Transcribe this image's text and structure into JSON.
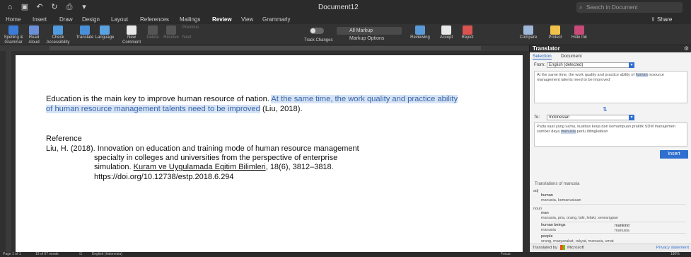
{
  "titlebar": {
    "title": "Document12",
    "search_placeholder": "Search in Document"
  },
  "menu_tabs": [
    {
      "label": "Home"
    },
    {
      "label": "Insert"
    },
    {
      "label": "Draw"
    },
    {
      "label": "Design"
    },
    {
      "label": "Layout"
    },
    {
      "label": "References"
    },
    {
      "label": "Mailings"
    },
    {
      "label": "Review"
    },
    {
      "label": "View"
    },
    {
      "label": "Grammarly"
    }
  ],
  "share_label": "Share",
  "ribbon": {
    "spelling": "Spelling & Grammar",
    "read_aloud": "Read Aloud",
    "check_accessibility": "Check Accessibility",
    "translate": "Translate",
    "language": "Language",
    "new_comment": "New Comment",
    "delete": "Delete",
    "resolve": "Resolve",
    "previous": "Previous",
    "next": "Next",
    "track_changes": "Track Changes",
    "markup_select": "All Markup",
    "markup_options": "Markup Options",
    "reviewing": "Reviewing",
    "accept": "Accept",
    "reject": "Reject",
    "compare": "Compare",
    "protect": "Protect",
    "hide_ink": "Hide Ink"
  },
  "document": {
    "para_plain": "Education is the main key to improve human resource of nation. ",
    "para_highlight": "At the same time, the work quality and practice ability of human resource management talents need to be improved",
    "para_cite": " (Liu, 2018).",
    "reference_heading": "Reference",
    "ref_line1": "Liu, H. (2018). Innovation on education and training mode of human resource management",
    "ref_line2": "specialty in colleges and universities from the perspective of enterprise",
    "ref_line3_pre": "simulation. ",
    "ref_journal": "Kuram ve Uygulamada Egitim Bilimleri",
    "ref_line3_post": ", 18(6), 3812–3818.",
    "ref_doi": "https://doi.org/10.12738/estp.2018.6.294"
  },
  "status": {
    "page": "Page 1 of 1",
    "words": "19 of 67 words",
    "language": "English (Indonesia)",
    "focus": "Focus",
    "zoom": "180%"
  },
  "translator": {
    "title": "Translator",
    "tab_selection": "Selection",
    "tab_document": "Document",
    "from_label": "From:",
    "from_value": "English (detected)",
    "source_pre": "At the same time, the work quality and practice ability of ",
    "source_word": "human",
    "source_post": " resource management talents need to be improved",
    "to_label": "To:",
    "to_value": "Indonesian",
    "target_pre": "Pada saat yang sama, kualitas kerja dan kemampuan praktik SDM manajemen sumber daya ",
    "target_word": "manusia",
    "target_post": " perlu ditingkatkan",
    "insert_label": "Insert",
    "dict_title": "Translations of manusia",
    "dict": [
      {
        "pos": "adj",
        "word": "human",
        "alts": "manusia, kemanusiaan"
      },
      {
        "pos": "noun",
        "word": "man",
        "alts": "manusia, pria, orang, laki, lelaki, seorangpun"
      },
      {
        "pos": "",
        "word": "human beings",
        "alts": "manusia"
      },
      {
        "pos": "",
        "word": "mankind",
        "alts": "manusia"
      },
      {
        "pos": "",
        "word": "people",
        "alts": "orang, masyarakat, rakyat, manusia, umat"
      }
    ],
    "footer_text": "Translated by",
    "footer_brand": "Microsoft",
    "privacy": "Privacy statement"
  }
}
